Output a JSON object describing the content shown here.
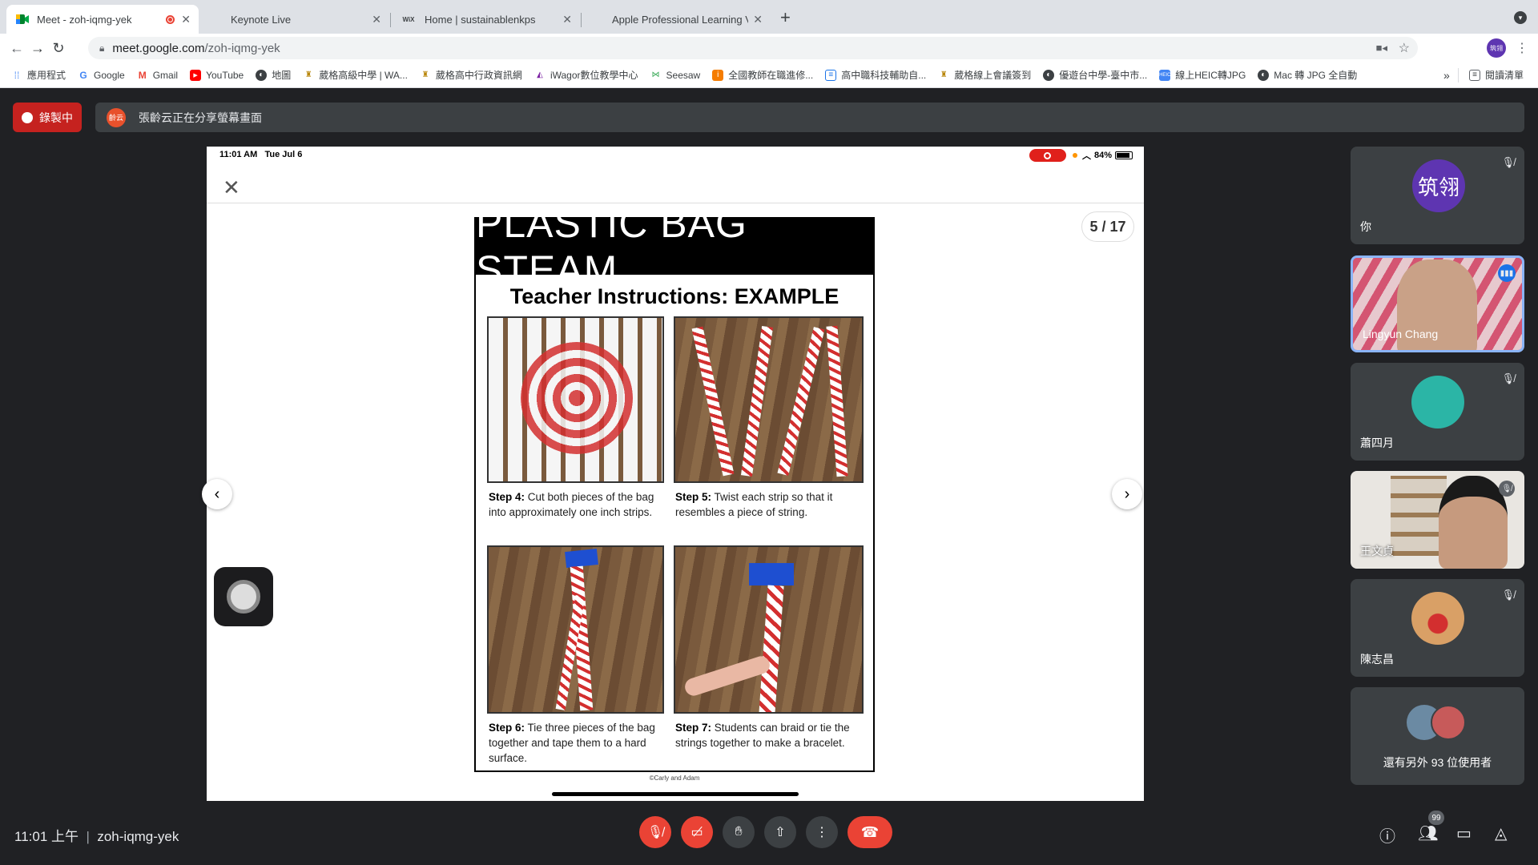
{
  "browser": {
    "tabs": [
      {
        "label": "Meet - zoh-iqmg-yek",
        "icon": "google-meet-icon",
        "recording": true
      },
      {
        "label": "Keynote Live",
        "icon": "apple-icon"
      },
      {
        "label": "Home | sustainablenkps",
        "icon": "wix-icon",
        "icon_text": "WiX"
      },
      {
        "label": "Apple Professional Learning Vi",
        "icon": "apple-icon"
      }
    ],
    "new_tab": "+",
    "url_domain": "meet.google.com",
    "url_path": "/zoh-iqmg-yek",
    "profile_initials": "筑翎",
    "bookmarks": [
      {
        "label": "應用程式",
        "icon": "apps-grid-icon"
      },
      {
        "label": "Google",
        "icon": "google-icon"
      },
      {
        "label": "Gmail",
        "icon": "gmail-icon"
      },
      {
        "label": "YouTube",
        "icon": "youtube-icon"
      },
      {
        "label": "地圖",
        "icon": "globe-icon"
      },
      {
        "label": "葳格高級中學 | WA...",
        "icon": "school-crest-icon"
      },
      {
        "label": "葳格高中行政資訊網",
        "icon": "school-crest-icon"
      },
      {
        "label": "iWagor數位教學中心",
        "icon": "iwagor-icon"
      },
      {
        "label": "Seesaw",
        "icon": "seesaw-icon"
      },
      {
        "label": "全國教師在職進修...",
        "icon": "teacher-icon"
      },
      {
        "label": "高中職科技輔助自...",
        "icon": "doc-icon"
      },
      {
        "label": "葳格線上會議簽到",
        "icon": "school-crest-icon"
      },
      {
        "label": "優遊台中學-臺中市...",
        "icon": "globe-icon"
      },
      {
        "label": "線上HEIC轉JPG",
        "icon": "heic-icon"
      },
      {
        "label": "Mac 轉 JPG 全自動",
        "icon": "globe-icon"
      }
    ],
    "more": "»",
    "reading_list": "閱讀清單"
  },
  "meet": {
    "recording_label": "錄製中",
    "presenter_avatar": "齡云",
    "sharing_text": "張齡云正在分享螢幕畫面",
    "time": "11:01 上午",
    "meeting_code": "zoh-iqmg-yek",
    "participant_badge": "99",
    "participants": [
      {
        "name": "你",
        "initials": "筑翎",
        "avatar_color": "#5e35b1",
        "muted": true
      },
      {
        "name": "Lingyun Chang",
        "speaking": true
      },
      {
        "name": "蕭四月",
        "muted": true
      },
      {
        "name": "王文貞",
        "muted": true
      },
      {
        "name": "陳志昌",
        "muted": true
      }
    ],
    "others_text": "還有另外 93 位使用者"
  },
  "ipad": {
    "time": "11:01 AM",
    "date": "Tue Jul 6",
    "battery": "84%",
    "page_counter": "5 / 17"
  },
  "slide": {
    "title": "PLASTIC BAG STEAM",
    "subtitle": "Teacher Instructions: EXAMPLE",
    "steps": [
      {
        "label": "Step 4:",
        "text": "Cut both pieces of the bag into approximately one inch strips."
      },
      {
        "label": "Step 5:",
        "text": "Twist each strip so that it resembles a piece of string."
      },
      {
        "label": "Step 6:",
        "text": "Tie three pieces of the bag together and tape them to a hard surface."
      },
      {
        "label": "Step 7:",
        "text": "Students can braid or tie the strings together to make a bracelet."
      }
    ],
    "credit": "©Carly and Adam"
  },
  "colors": {
    "meet_bg": "#202124",
    "tile_bg": "#3c4043",
    "danger": "#ea4335",
    "accent": "#8ab4f8"
  }
}
